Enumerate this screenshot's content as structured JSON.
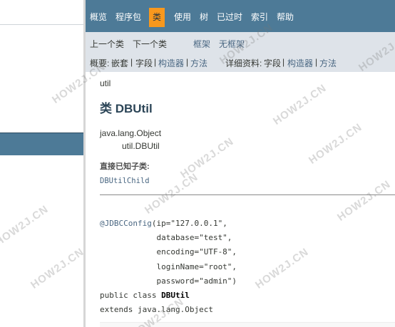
{
  "nav": {
    "items": [
      "概览",
      "程序包",
      "类",
      "使用",
      "树",
      "已过时",
      "索引",
      "帮助"
    ],
    "active": "类"
  },
  "subnav": {
    "prev_class": "上一个类",
    "next_class": "下一个类",
    "frames": "框架",
    "no_frames": "无框架",
    "summary_label": "概要:",
    "summary_nested": "嵌套",
    "summary_field": "字段",
    "summary_constructor": "构造器",
    "summary_method": "方法",
    "detail_label": "详细资料:",
    "detail_field": "字段",
    "detail_constructor": "构造器",
    "detail_method": "方法",
    "sep": "|"
  },
  "class_info": {
    "package": "util",
    "title": "类 DBUtil",
    "hierarchy_parent": "java.lang.Object",
    "hierarchy_child": "util.DBUtil",
    "subclasses_heading": "直接已知子类:",
    "subclass": "DBUtilChild"
  },
  "signature": {
    "annotation": "@JDBCConfig",
    "line1_rest": "(ip=\"127.0.0.1\",",
    "line2": "            database=\"test\",",
    "line3": "            encoding=\"UTF-8\",",
    "line4": "            loginName=\"root\",",
    "line5": "            password=\"admin\")",
    "decl_prefix": "public class ",
    "decl_name": "DBUtil",
    "extends": "extends java.lang.Object"
  },
  "watermark": "HOW2J.CN",
  "colors": {
    "nav_bg": "#4d7a97",
    "nav_active_bg": "#f8981d",
    "subnav_bg": "#dee3e9",
    "link": "#4a6782"
  }
}
